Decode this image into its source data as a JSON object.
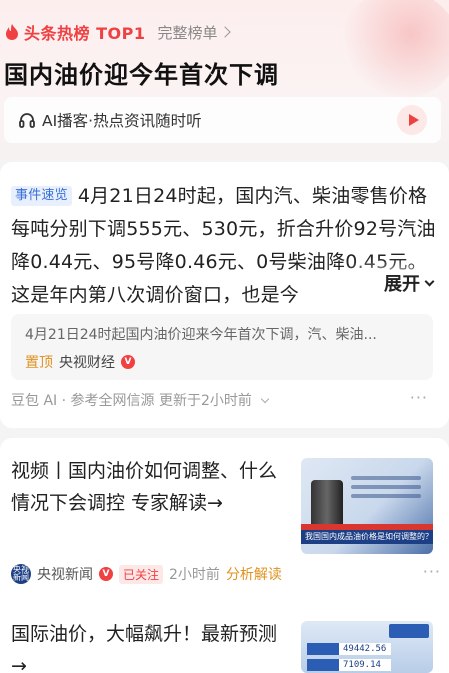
{
  "hot": {
    "label": "头条热榜 TOP1",
    "full_list": "完整榜单",
    "accent": "#f04142"
  },
  "headline": "国内油价迎今年首次下调",
  "ai_bar": {
    "text": "AI播客·热点资讯随时听",
    "icon": "headphone-icon",
    "play_icon": "play-icon"
  },
  "summary": {
    "tag": "事件速览",
    "text": "4月21日24时起，国内汽、柴油零售价格每吨分别下调555元、530元，折合升价92号汽油降0.44元、95号降0.46元、0号柴油降0.45元。这是年内第八次调价窗口，也是今",
    "expand": "展开"
  },
  "quote": {
    "text": "4月21日24时起国内油价迎来今年首次下调，汽、柴油...",
    "pin": "置顶",
    "source": "央视财经",
    "verified": "V"
  },
  "source_row": {
    "text": "豆包 AI · 参考全网信源 更新于2小时前",
    "more": "···"
  },
  "news": [
    {
      "title": "视频丨国内油价如何调整、什么情况下会调控 专家解读→",
      "author": "央视新闻",
      "avatar_text": "央视\n新闻",
      "verified": "V",
      "followed": "已关注",
      "time": "2小时前",
      "analysis": "分析解读",
      "more": "···",
      "thumb_caption": "我国国内成品油价格是如何调整的？"
    },
    {
      "title": "国际油价，大幅飙升！最新预测→",
      "thumb_values": [
        "49442.56",
        "7109.14"
      ]
    }
  ]
}
